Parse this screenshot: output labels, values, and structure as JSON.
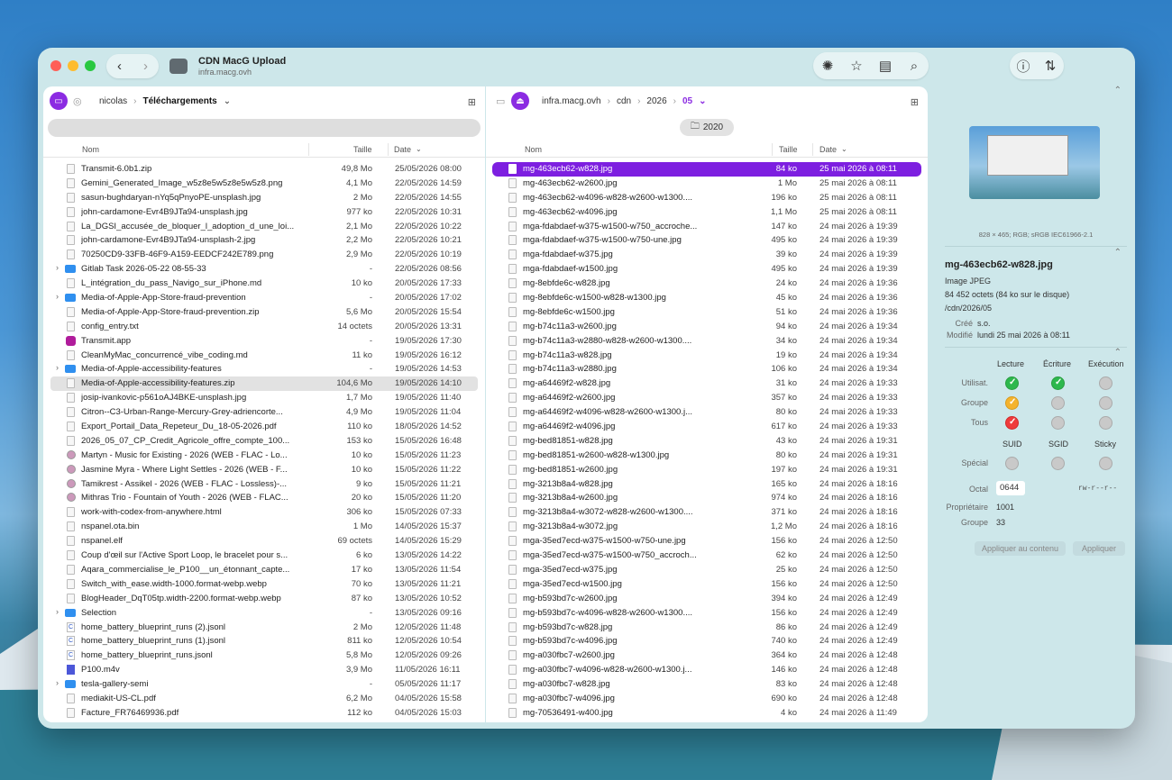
{
  "window": {
    "title": "CDN MacG Upload",
    "subtitle": "infra.macg.ovh"
  },
  "left_pane": {
    "breadcrumb": [
      "nicolas",
      "Téléchargements"
    ],
    "columns": {
      "name": "Nom",
      "size": "Taille",
      "date": "Date"
    },
    "rows": [
      {
        "name": "Transmit-6.0b1.zip",
        "size": "49,8 Mo",
        "date": "25/05/2026 08:00",
        "kind": "file"
      },
      {
        "name": "Gemini_Generated_Image_w5z8e5w5z8e5w5z8.png",
        "size": "4,1 Mo",
        "date": "22/05/2026 14:59",
        "kind": "file"
      },
      {
        "name": "sasun-bughdaryan-nYq5qPnyoPE-unsplash.jpg",
        "size": "2 Mo",
        "date": "22/05/2026 14:55",
        "kind": "file"
      },
      {
        "name": "john-cardamone-Evr4B9JTa94-unsplash.jpg",
        "size": "977 ko",
        "date": "22/05/2026 10:31",
        "kind": "file"
      },
      {
        "name": "La_DGSI_accusée_de_bloquer_l_adoption_d_une_loi...",
        "size": "2,1 Mo",
        "date": "22/05/2026 10:22",
        "kind": "file"
      },
      {
        "name": "john-cardamone-Evr4B9JTa94-unsplash-2.jpg",
        "size": "2,2 Mo",
        "date": "22/05/2026 10:21",
        "kind": "file"
      },
      {
        "name": "70250CD9-33FB-46F9-A159-EEDCF242E789.png",
        "size": "2,9 Mo",
        "date": "22/05/2026 10:19",
        "kind": "file"
      },
      {
        "name": "Gitlab Task 2026-05-22 08-55-33",
        "size": "-",
        "date": "22/05/2026 08:56",
        "kind": "folder"
      },
      {
        "name": "L_intégration_du_pass_Navigo_sur_iPhone.md",
        "size": "10 ko",
        "date": "20/05/2026 17:33",
        "kind": "file"
      },
      {
        "name": "Media-of-Apple-App-Store-fraud-prevention",
        "size": "-",
        "date": "20/05/2026 17:02",
        "kind": "folder"
      },
      {
        "name": "Media-of-Apple-App-Store-fraud-prevention.zip",
        "size": "5,6 Mo",
        "date": "20/05/2026 15:54",
        "kind": "file"
      },
      {
        "name": "config_entry.txt",
        "size": "14 octets",
        "date": "20/05/2026 13:31",
        "kind": "file"
      },
      {
        "name": "Transmit.app",
        "size": "-",
        "date": "19/05/2026 17:30",
        "kind": "app"
      },
      {
        "name": "CleanMyMac_concurrencé_vibe_coding.md",
        "size": "11 ko",
        "date": "19/05/2026 16:12",
        "kind": "file"
      },
      {
        "name": "Media-of-Apple-accessibility-features",
        "size": "-",
        "date": "19/05/2026 14:53",
        "kind": "folder"
      },
      {
        "name": "Media-of-Apple-accessibility-features.zip",
        "size": "104,6 Mo",
        "date": "19/05/2026 14:10",
        "kind": "file",
        "highlight": true
      },
      {
        "name": "josip-ivankovic-p561oAJ4BKE-unsplash.jpg",
        "size": "1,7 Mo",
        "date": "19/05/2026 11:40",
        "kind": "file"
      },
      {
        "name": "Citron--C3-Urban-Range-Mercury-Grey-adriencorte...",
        "size": "4,9 Mo",
        "date": "19/05/2026 11:04",
        "kind": "file"
      },
      {
        "name": "Export_Portail_Data_Repeteur_Du_18-05-2026.pdf",
        "size": "110 ko",
        "date": "18/05/2026 14:52",
        "kind": "file"
      },
      {
        "name": "2026_05_07_CP_Credit_Agricole_offre_compte_100...",
        "size": "153 ko",
        "date": "15/05/2026 16:48",
        "kind": "file"
      },
      {
        "name": "Martyn - Music for Existing - 2026 (WEB - FLAC - Lo...",
        "size": "10 ko",
        "date": "15/05/2026 11:23",
        "kind": "audio"
      },
      {
        "name": "Jasmine Myra - Where Light Settles - 2026 (WEB - F...",
        "size": "10 ko",
        "date": "15/05/2026 11:22",
        "kind": "audio"
      },
      {
        "name": "Tamikrest - Assikel - 2026 (WEB - FLAC - Lossless)-...",
        "size": "9 ko",
        "date": "15/05/2026 11:21",
        "kind": "audio"
      },
      {
        "name": "Mithras Trio - Fountain of Youth - 2026 (WEB - FLAC...",
        "size": "20 ko",
        "date": "15/05/2026 11:20",
        "kind": "audio"
      },
      {
        "name": "work-with-codex-from-anywhere.html",
        "size": "306 ko",
        "date": "15/05/2026 07:33",
        "kind": "file"
      },
      {
        "name": "nspanel.ota.bin",
        "size": "1 Mo",
        "date": "14/05/2026 15:37",
        "kind": "file"
      },
      {
        "name": "nspanel.elf",
        "size": "69 octets",
        "date": "14/05/2026 15:29",
        "kind": "file"
      },
      {
        "name": "Coup d'œil sur l'Active Sport Loop, le bracelet pour s...",
        "size": "6 ko",
        "date": "13/05/2026 14:22",
        "kind": "file"
      },
      {
        "name": "Aqara_commercialise_le_P100__un_étonnant_capte...",
        "size": "17 ko",
        "date": "13/05/2026 11:54",
        "kind": "file"
      },
      {
        "name": "Switch_with_ease.width-1000.format-webp.webp",
        "size": "70 ko",
        "date": "13/05/2026 11:21",
        "kind": "file"
      },
      {
        "name": "BlogHeader_DqT05tp.width-2200.format-webp.webp",
        "size": "87 ko",
        "date": "13/05/2026 10:52",
        "kind": "file"
      },
      {
        "name": "Selection",
        "size": "-",
        "date": "13/05/2026 09:16",
        "kind": "folder"
      },
      {
        "name": "home_battery_blueprint_runs (2).jsonl",
        "size": "2 Mo",
        "date": "12/05/2026 11:48",
        "kind": "json"
      },
      {
        "name": "home_battery_blueprint_runs (1).jsonl",
        "size": "811 ko",
        "date": "12/05/2026 10:54",
        "kind": "json"
      },
      {
        "name": "home_battery_blueprint_runs.jsonl",
        "size": "5,8 Mo",
        "date": "12/05/2026 09:26",
        "kind": "json"
      },
      {
        "name": "P100.m4v",
        "size": "3,9 Mo",
        "date": "11/05/2026 16:11",
        "kind": "video"
      },
      {
        "name": "tesla-gallery-semi",
        "size": "-",
        "date": "05/05/2026 11:17",
        "kind": "folder"
      },
      {
        "name": "mediakit-US-CL.pdf",
        "size": "6,2 Mo",
        "date": "04/05/2026 15:58",
        "kind": "file"
      },
      {
        "name": "Facture_FR76469936.pdf",
        "size": "112 ko",
        "date": "04/05/2026 15:03",
        "kind": "file"
      }
    ]
  },
  "right_pane": {
    "breadcrumb": [
      "infra.macg.ovh",
      "cdn",
      "2026",
      "05"
    ],
    "folder_tag": "2020",
    "columns": {
      "name": "Nom",
      "size": "Taille",
      "date": "Date"
    },
    "rows": [
      {
        "name": "mg-463ecb62-w828.jpg",
        "size": "84 ko",
        "date": "25 mai 2026 à 08:11",
        "selected": true
      },
      {
        "name": "mg-463ecb62-w2600.jpg",
        "size": "1 Mo",
        "date": "25 mai 2026 à 08:11"
      },
      {
        "name": "mg-463ecb62-w4096-w828-w2600-w1300....",
        "size": "196 ko",
        "date": "25 mai 2026 à 08:11"
      },
      {
        "name": "mg-463ecb62-w4096.jpg",
        "size": "1,1 Mo",
        "date": "25 mai 2026 à 08:11"
      },
      {
        "name": "mga-fdabdaef-w375-w1500-w750_accroche...",
        "size": "147 ko",
        "date": "24 mai 2026 à 19:39"
      },
      {
        "name": "mga-fdabdaef-w375-w1500-w750-une.jpg",
        "size": "495 ko",
        "date": "24 mai 2026 à 19:39"
      },
      {
        "name": "mga-fdabdaef-w375.jpg",
        "size": "39 ko",
        "date": "24 mai 2026 à 19:39"
      },
      {
        "name": "mga-fdabdaef-w1500.jpg",
        "size": "495 ko",
        "date": "24 mai 2026 à 19:39"
      },
      {
        "name": "mg-8ebfde6c-w828.jpg",
        "size": "24 ko",
        "date": "24 mai 2026 à 19:36"
      },
      {
        "name": "mg-8ebfde6c-w1500-w828-w1300.jpg",
        "size": "45 ko",
        "date": "24 mai 2026 à 19:36"
      },
      {
        "name": "mg-8ebfde6c-w1500.jpg",
        "size": "51 ko",
        "date": "24 mai 2026 à 19:36"
      },
      {
        "name": "mg-b74c11a3-w2600.jpg",
        "size": "94 ko",
        "date": "24 mai 2026 à 19:34"
      },
      {
        "name": "mg-b74c11a3-w2880-w828-w2600-w1300....",
        "size": "34 ko",
        "date": "24 mai 2026 à 19:34"
      },
      {
        "name": "mg-b74c11a3-w828.jpg",
        "size": "19 ko",
        "date": "24 mai 2026 à 19:34"
      },
      {
        "name": "mg-b74c11a3-w2880.jpg",
        "size": "106 ko",
        "date": "24 mai 2026 à 19:34"
      },
      {
        "name": "mg-a64469f2-w828.jpg",
        "size": "31 ko",
        "date": "24 mai 2026 à 19:33"
      },
      {
        "name": "mg-a64469f2-w2600.jpg",
        "size": "357 ko",
        "date": "24 mai 2026 à 19:33"
      },
      {
        "name": "mg-a64469f2-w4096-w828-w2600-w1300.j...",
        "size": "80 ko",
        "date": "24 mai 2026 à 19:33"
      },
      {
        "name": "mg-a64469f2-w4096.jpg",
        "size": "617 ko",
        "date": "24 mai 2026 à 19:33"
      },
      {
        "name": "mg-bed81851-w828.jpg",
        "size": "43 ko",
        "date": "24 mai 2026 à 19:31"
      },
      {
        "name": "mg-bed81851-w2600-w828-w1300.jpg",
        "size": "80 ko",
        "date": "24 mai 2026 à 19:31"
      },
      {
        "name": "mg-bed81851-w2600.jpg",
        "size": "197 ko",
        "date": "24 mai 2026 à 19:31"
      },
      {
        "name": "mg-3213b8a4-w828.jpg",
        "size": "165 ko",
        "date": "24 mai 2026 à 18:16"
      },
      {
        "name": "mg-3213b8a4-w2600.jpg",
        "size": "974 ko",
        "date": "24 mai 2026 à 18:16"
      },
      {
        "name": "mg-3213b8a4-w3072-w828-w2600-w1300....",
        "size": "371 ko",
        "date": "24 mai 2026 à 18:16"
      },
      {
        "name": "mg-3213b8a4-w3072.jpg",
        "size": "1,2 Mo",
        "date": "24 mai 2026 à 18:16"
      },
      {
        "name": "mga-35ed7ecd-w375-w1500-w750-une.jpg",
        "size": "156 ko",
        "date": "24 mai 2026 à 12:50"
      },
      {
        "name": "mga-35ed7ecd-w375-w1500-w750_accroch...",
        "size": "62 ko",
        "date": "24 mai 2026 à 12:50"
      },
      {
        "name": "mga-35ed7ecd-w375.jpg",
        "size": "25 ko",
        "date": "24 mai 2026 à 12:50"
      },
      {
        "name": "mga-35ed7ecd-w1500.jpg",
        "size": "156 ko",
        "date": "24 mai 2026 à 12:50"
      },
      {
        "name": "mg-b593bd7c-w2600.jpg",
        "size": "394 ko",
        "date": "24 mai 2026 à 12:49"
      },
      {
        "name": "mg-b593bd7c-w4096-w828-w2600-w1300....",
        "size": "156 ko",
        "date": "24 mai 2026 à 12:49"
      },
      {
        "name": "mg-b593bd7c-w828.jpg",
        "size": "86 ko",
        "date": "24 mai 2026 à 12:49"
      },
      {
        "name": "mg-b593bd7c-w4096.jpg",
        "size": "740 ko",
        "date": "24 mai 2026 à 12:49"
      },
      {
        "name": "mg-a030fbc7-w2600.jpg",
        "size": "364 ko",
        "date": "24 mai 2026 à 12:48"
      },
      {
        "name": "mg-a030fbc7-w4096-w828-w2600-w1300.j...",
        "size": "146 ko",
        "date": "24 mai 2026 à 12:48"
      },
      {
        "name": "mg-a030fbc7-w828.jpg",
        "size": "83 ko",
        "date": "24 mai 2026 à 12:48"
      },
      {
        "name": "mg-a030fbc7-w4096.jpg",
        "size": "690 ko",
        "date": "24 mai 2026 à 12:48"
      },
      {
        "name": "mg-70536491-w400.jpg",
        "size": "4 ko",
        "date": "24 mai 2026 à 11:49"
      }
    ]
  },
  "inspector": {
    "image_meta": "828 × 465; RGB; sRGB IEC61966-2.1",
    "file_name": "mg-463ecb62-w828.jpg",
    "kind": "Image JPEG",
    "bytes": "84 452 octets (84 ko sur le disque)",
    "path": "/cdn/2026/05",
    "created_label": "Créé",
    "created_value": "s.o.",
    "modified_label": "Modifié",
    "modified_value": "lundi 25 mai 2026 à 08:11",
    "perm_headers": [
      "Lecture",
      "Écriture",
      "Exécution"
    ],
    "perm_rows": [
      "Utilisat.",
      "Groupe",
      "Tous"
    ],
    "special_headers": [
      "SUID",
      "SGID",
      "Sticky"
    ],
    "special_label": "Spécial",
    "octal_label": "Octal",
    "octal_value": "0644",
    "symbolic": "rw-r--r--",
    "owner_label": "Propriétaire",
    "owner_value": "1001",
    "group_label": "Groupe",
    "group_value": "33",
    "apply_content": "Appliquer au contenu",
    "apply": "Appliquer"
  },
  "icons": [
    "chevron-left-icon",
    "chevron-right-icon",
    "app-icon",
    "sync-icon",
    "star-icon",
    "layout-icon",
    "search-icon",
    "info-icon",
    "transfer-icon",
    "disk-icon",
    "globe-icon",
    "grid-icon",
    "eject-icon",
    "folder-icon"
  ]
}
